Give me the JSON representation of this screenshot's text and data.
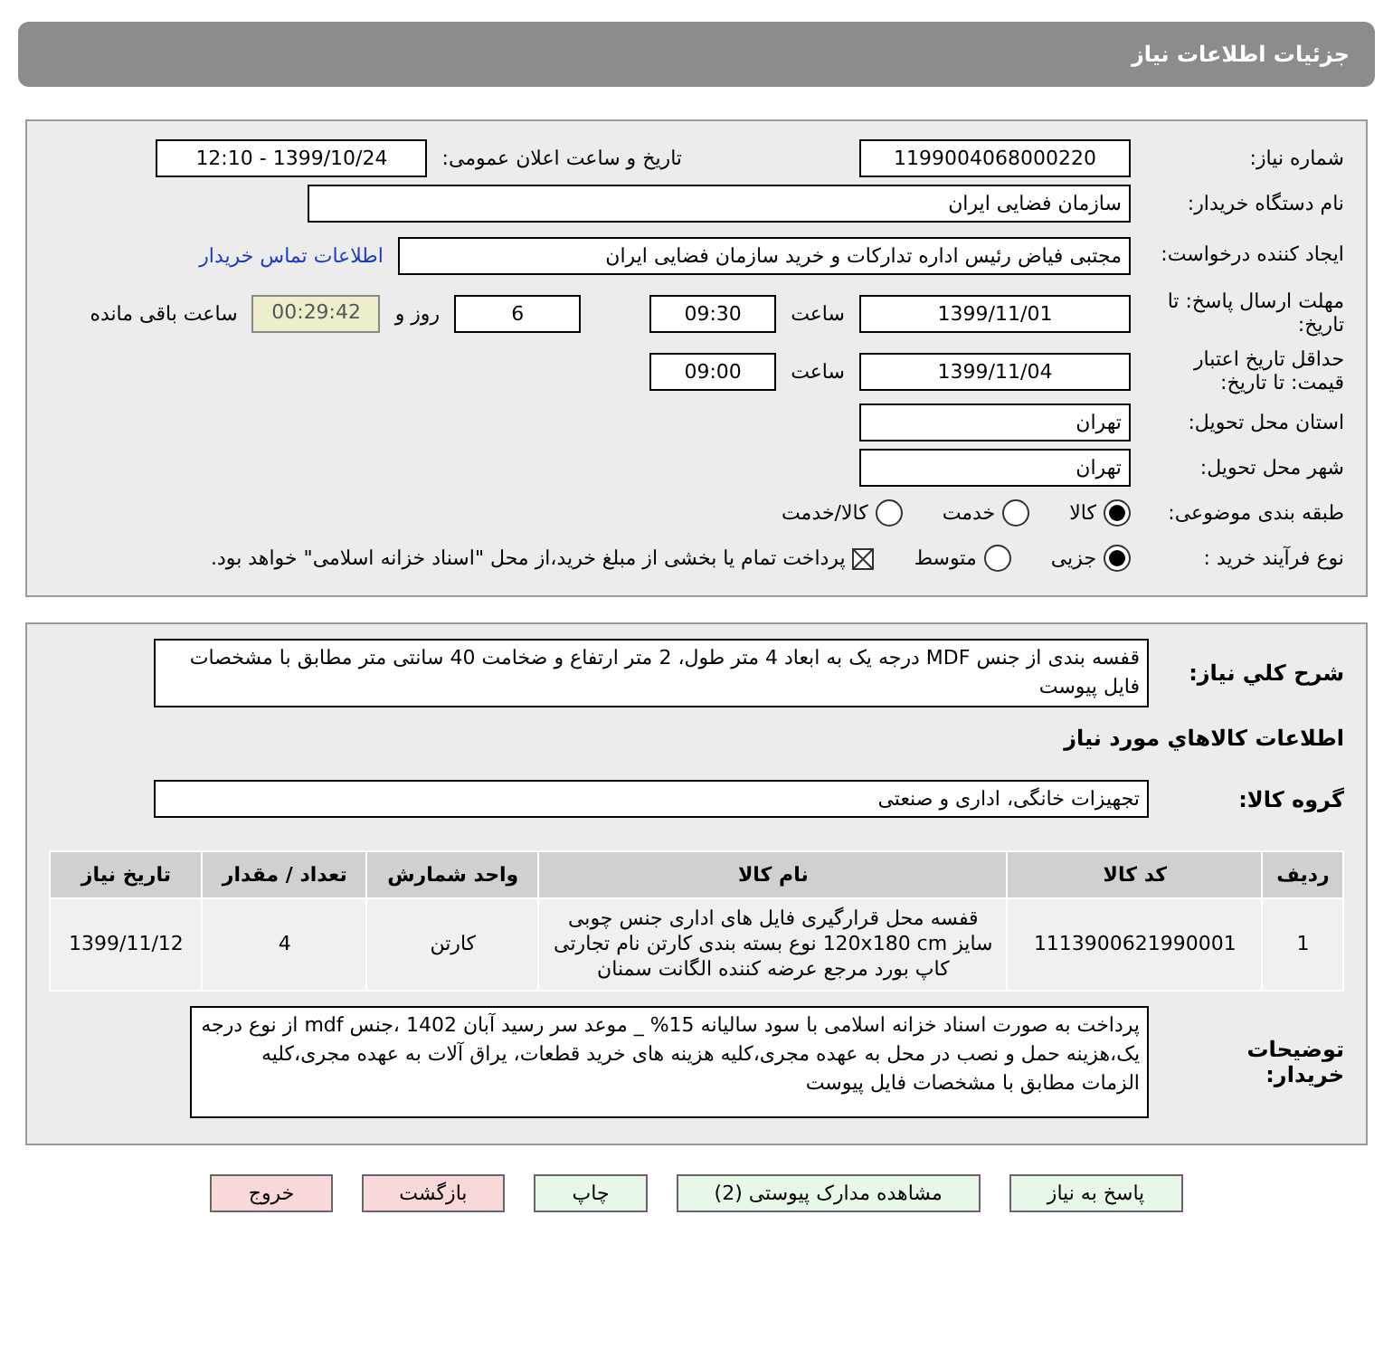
{
  "header": {
    "title": "جزئیات اطلاعات نیاز"
  },
  "need_number": {
    "label": "شماره نیاز:",
    "value": "1199004068000220"
  },
  "announce": {
    "label": "تاریخ و ساعت اعلان عمومی:",
    "value": "1399/10/24 - 12:10"
  },
  "buyer_org": {
    "label": "نام دستگاه خریدار:",
    "value": "سازمان فضایی ایران"
  },
  "requester": {
    "label": "ایجاد کننده درخواست:",
    "value": "مجتبی  فیاض رئیس اداره تدارکات و خرید سازمان فضایی ایران",
    "link": "اطلاعات تماس خریدار"
  },
  "deadline": {
    "label": "مهلت ارسال پاسخ: تا تاریخ:",
    "date": "1399/11/01",
    "time_label": "ساعت",
    "time": "09:30",
    "days": "6",
    "days_label": "روز و",
    "remaining": "00:29:42",
    "remaining_label": "ساعت باقی مانده"
  },
  "validity": {
    "label": "حداقل تاریخ اعتبار قیمت: تا تاریخ:",
    "date": "1399/11/04",
    "time_label": "ساعت",
    "time": "09:00"
  },
  "province": {
    "label": "استان محل تحویل:",
    "value": "تهران"
  },
  "city": {
    "label": "شهر محل تحویل:",
    "value": "تهران"
  },
  "category": {
    "label": "طبقه بندی موضوعی:",
    "options": [
      {
        "label": "کالا",
        "selected": true
      },
      {
        "label": "خدمت",
        "selected": false
      },
      {
        "label": "کالا/خدمت",
        "selected": false
      }
    ]
  },
  "process": {
    "label": "نوع فرآیند خرید :",
    "options": [
      {
        "label": "جزیی",
        "selected": true
      },
      {
        "label": "متوسط",
        "selected": false
      }
    ],
    "payment": {
      "label": "پرداخت تمام یا بخشی از مبلغ خرید،از محل \"اسناد خزانه اسلامی\" خواهد بود.",
      "checked": true
    }
  },
  "description": {
    "label": "شرح کلي نياز:",
    "value": "قفسه بندی از جنس MDF درجه یک به ابعاد 4 متر طول، 2 متر ارتفاع و ضخامت 40 سانتی متر مطابق با مشخصات فایل پیوست"
  },
  "goods_section": {
    "title": "اطلاعات کالاهاي مورد نياز"
  },
  "goods_group": {
    "label": "گروه کالا:",
    "value": "تجهیزات خانگی، اداری و صنعتی"
  },
  "table": {
    "columns": [
      "ردیف",
      "کد کالا",
      "نام کالا",
      "واحد شمارش",
      "تعداد / مقدار",
      "تاریخ نیاز"
    ],
    "rows": [
      [
        "1",
        "1113900621990001",
        "قفسه محل قرارگیری فایل های اداری جنس چوبی سایز 120x180 cm نوع بسته بندی کارتن نام تجارتی کاپ بورد مرجع عرضه کننده الگانت سمنان",
        "کارتن",
        "4",
        "1399/11/12"
      ]
    ]
  },
  "buyer_notes": {
    "label": "توضیحات خریدار:",
    "value": "پرداخت به صورت اسناد خزانه اسلامی با سود سالیانه 15% _ موعد سر رسید آبان 1402 ،جنس mdf از نوع درجه یک،هزینه حمل و نصب در محل به عهده مجری،کلیه هزینه های خرید قطعات، یراق آلات به عهده مجری،کلیه الزمات مطابق با مشخصات فایل پیوست"
  },
  "buttons": [
    {
      "label": "پاسخ به نیاز",
      "kind": "green"
    },
    {
      "label": "مشاهده مدارک پیوستی (2)",
      "kind": "green"
    },
    {
      "label": "چاپ",
      "kind": "green"
    },
    {
      "label": "بازگشت",
      "kind": "red"
    },
    {
      "label": "خروج",
      "kind": "red"
    }
  ]
}
